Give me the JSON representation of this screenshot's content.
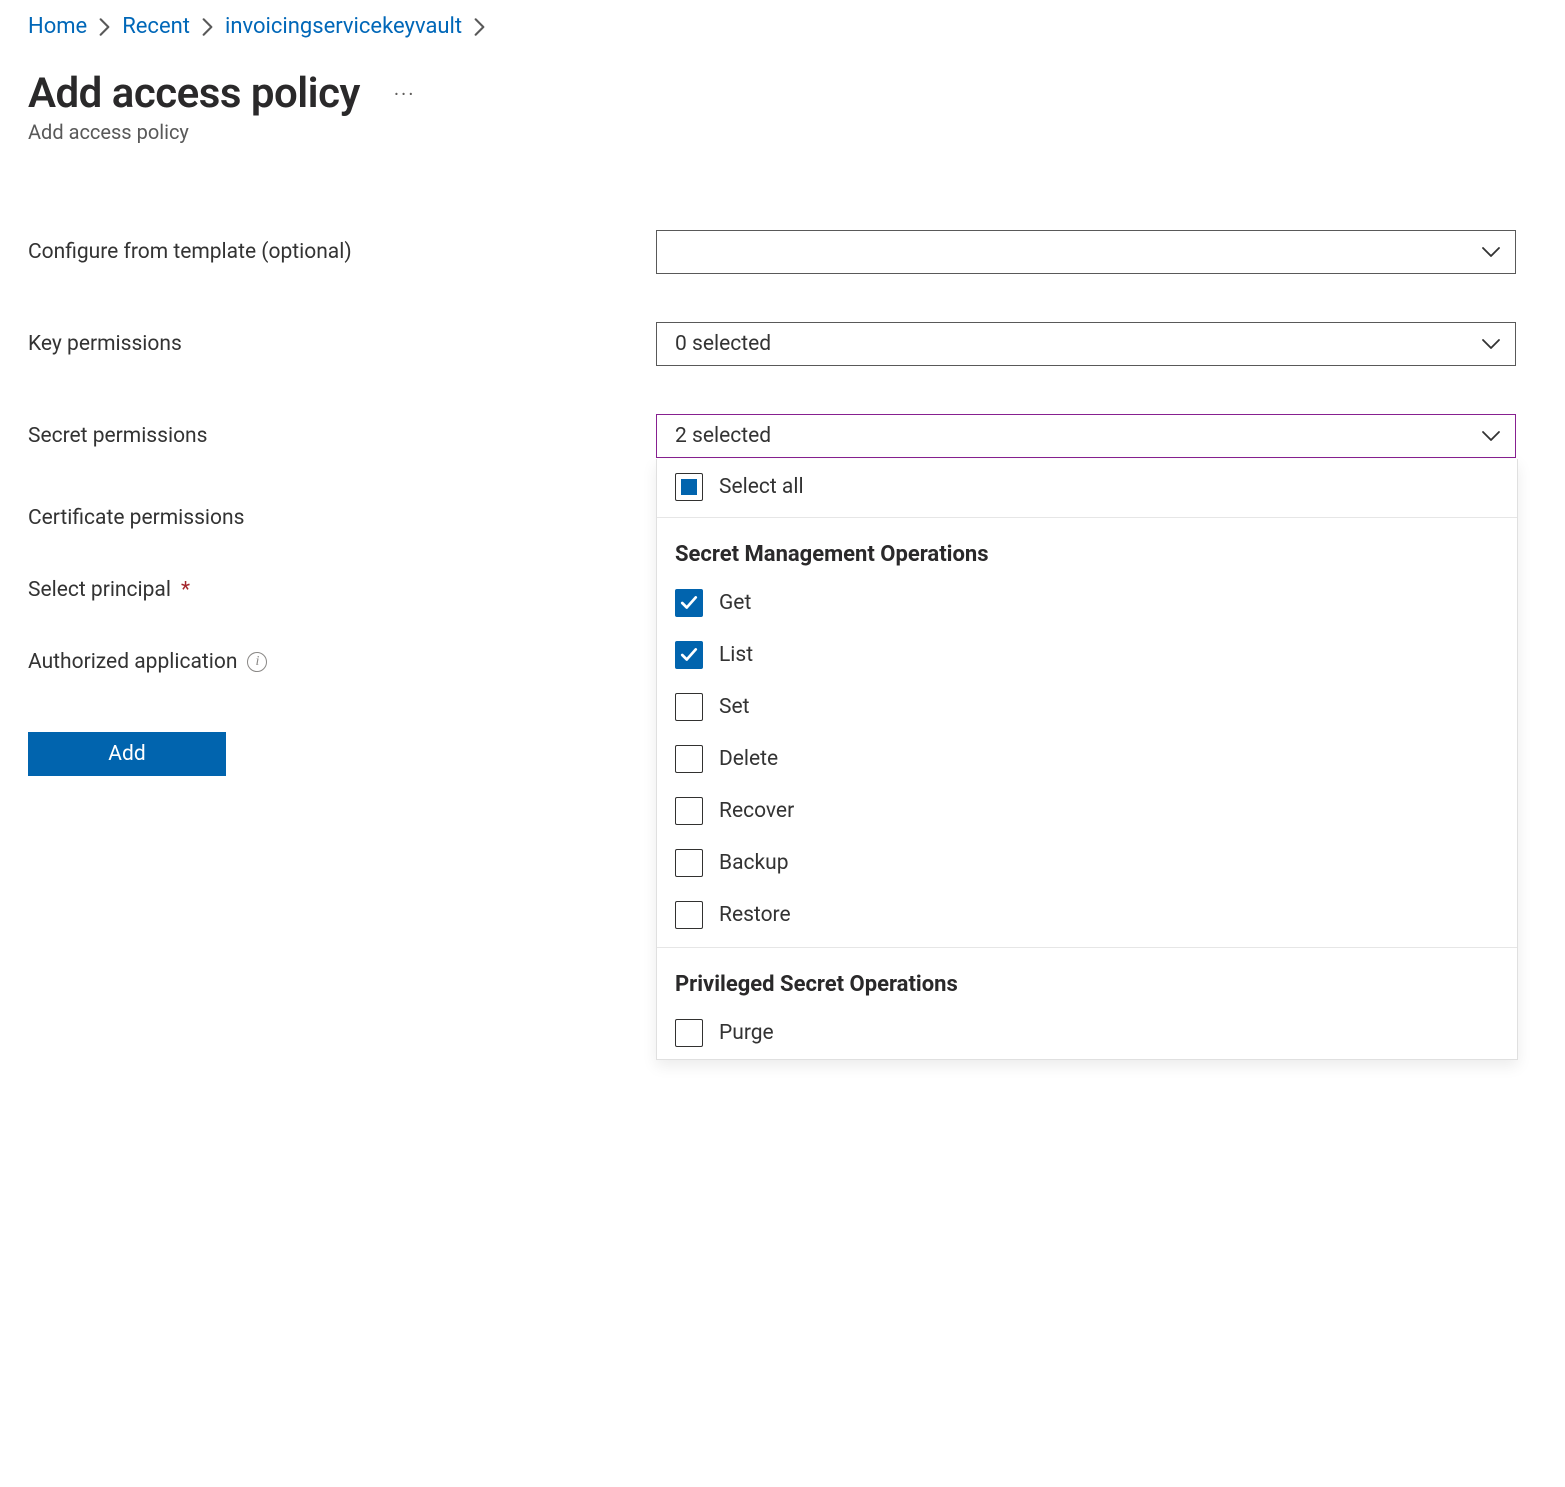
{
  "breadcrumbs": {
    "items": [
      {
        "label": "Home"
      },
      {
        "label": "Recent"
      },
      {
        "label": "invoicingservicekeyvault"
      }
    ]
  },
  "header": {
    "title": "Add access policy",
    "subtitle": "Add access policy",
    "more_icon_name": "more-horizontal-icon"
  },
  "form": {
    "template_label": "Configure from template (optional)",
    "template_value": "",
    "key_permissions_label": "Key permissions",
    "key_permissions_value": "0 selected",
    "secret_permissions_label": "Secret permissions",
    "secret_permissions_value": "2 selected",
    "certificate_permissions_label": "Certificate permissions",
    "select_principal_label": "Select principal",
    "authorized_application_label": "Authorized application",
    "add_button_label": "Add"
  },
  "secret_dropdown": {
    "select_all_label": "Select all",
    "select_all_state": "indeterminate",
    "groups": [
      {
        "title": "Secret Management Operations",
        "items": [
          {
            "label": "Get",
            "checked": true
          },
          {
            "label": "List",
            "checked": true
          },
          {
            "label": "Set",
            "checked": false
          },
          {
            "label": "Delete",
            "checked": false
          },
          {
            "label": "Recover",
            "checked": false
          },
          {
            "label": "Backup",
            "checked": false
          },
          {
            "label": "Restore",
            "checked": false
          }
        ]
      },
      {
        "title": "Privileged Secret Operations",
        "items": [
          {
            "label": "Purge",
            "checked": false
          }
        ]
      }
    ]
  },
  "colors": {
    "link": "#0067b8",
    "primary": "#0164ae",
    "active_border": "#872090",
    "text": "#323130"
  }
}
